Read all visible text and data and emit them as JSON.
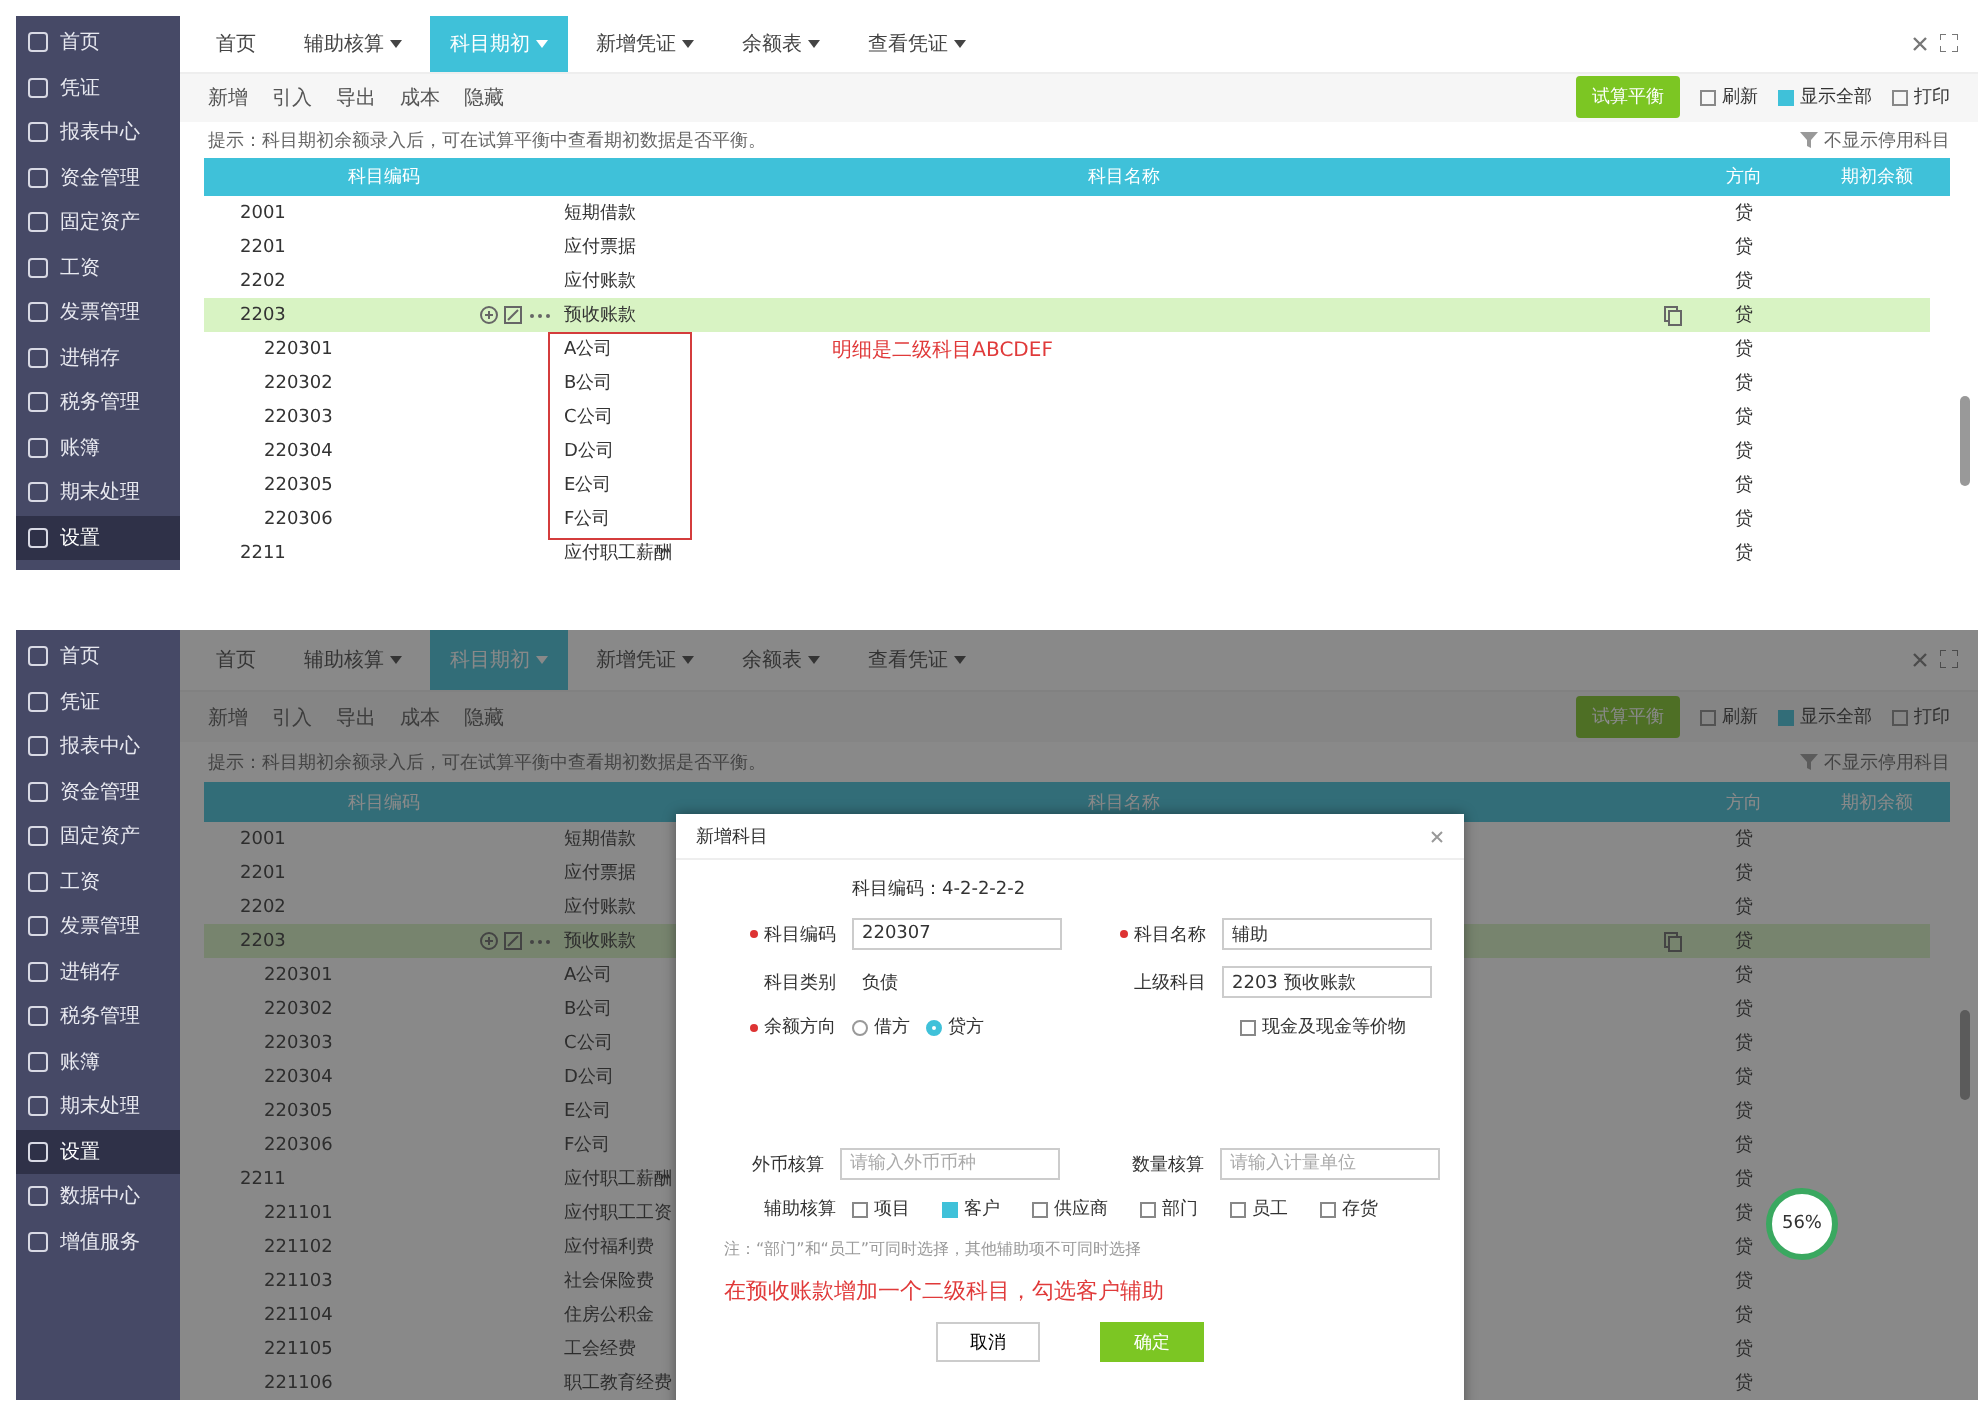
{
  "screens": [
    {
      "sidebar": {
        "items": [
          {
            "label": "首页",
            "selected": false
          },
          {
            "label": "凭证",
            "selected": false
          },
          {
            "label": "报表中心",
            "selected": false
          },
          {
            "label": "资金管理",
            "selected": false
          },
          {
            "label": "固定资产",
            "selected": false
          },
          {
            "label": "工资",
            "selected": false
          },
          {
            "label": "发票管理",
            "selected": false
          },
          {
            "label": "进销存",
            "selected": false
          },
          {
            "label": "税务管理",
            "selected": false
          },
          {
            "label": "账簿",
            "selected": false
          },
          {
            "label": "期末处理",
            "selected": false
          },
          {
            "label": "设置",
            "selected": true
          }
        ]
      },
      "tabs": [
        {
          "label": "首页",
          "selected": false,
          "dropdown": false
        },
        {
          "label": "辅助核算",
          "selected": false,
          "dropdown": true
        },
        {
          "label": "科目期初",
          "selected": true,
          "dropdown": true
        },
        {
          "label": "新增凭证",
          "selected": false,
          "dropdown": true
        },
        {
          "label": "余额表",
          "selected": false,
          "dropdown": true
        },
        {
          "label": "查看凭证",
          "selected": false,
          "dropdown": true
        }
      ],
      "toolbar": [
        "新增",
        "引入",
        "导出",
        "成本",
        "隐藏"
      ],
      "primary_action": "试算平衡",
      "options": [
        {
          "label": "刷新",
          "checked": false
        },
        {
          "label": "显示全部",
          "checked": true
        },
        {
          "label": "打印",
          "checked": false
        }
      ],
      "filter": "不显示停用科目",
      "hint": "提示：科目期初余额录入后，可在试算平衡中查看期初数据是否平衡。",
      "table": {
        "columns": [
          "科目编码",
          "科目名称",
          "方向",
          "期初余额"
        ],
        "rows": [
          {
            "code": "2001",
            "name": "短期借款",
            "direction": "贷",
            "selected": false
          },
          {
            "code": "2201",
            "name": "应付票据",
            "direction": "贷",
            "selected": false
          },
          {
            "code": "2202",
            "name": "应付账款",
            "direction": "贷",
            "selected": false
          },
          {
            "code": "2203",
            "name": "预收账款",
            "direction": "贷",
            "selected": true,
            "children": [
              {
                "code": "220301",
                "name": "A公司",
                "direction": "贷",
                "selected": false
              },
              {
                "code": "220302",
                "name": "B公司",
                "direction": "贷",
                "selected": false
              },
              {
                "code": "220303",
                "name": "C公司",
                "direction": "贷",
                "selected": false
              },
              {
                "code": "220304",
                "name": "D公司",
                "direction": "贷",
                "selected": false
              },
              {
                "code": "220305",
                "name": "E公司",
                "direction": "贷",
                "selected": false
              },
              {
                "code": "220306",
                "name": "F公司",
                "direction": "贷",
                "selected": false
              }
            ]
          },
          {
            "code": "2211",
            "name": "应付职工薪酬",
            "direction": "贷",
            "selected": false
          }
        ]
      },
      "annotation": "明细是二级科目ABCDEF"
    },
    {
      "sidebar": {
        "items": [
          {
            "label": "首页",
            "selected": false
          },
          {
            "label": "凭证",
            "selected": false
          },
          {
            "label": "报表中心",
            "selected": false
          },
          {
            "label": "资金管理",
            "selected": false
          },
          {
            "label": "固定资产",
            "selected": false
          },
          {
            "label": "工资",
            "selected": false
          },
          {
            "label": "发票管理",
            "selected": false
          },
          {
            "label": "进销存",
            "selected": false
          },
          {
            "label": "税务管理",
            "selected": false
          },
          {
            "label": "账簿",
            "selected": false
          },
          {
            "label": "期末处理",
            "selected": false
          },
          {
            "label": "设置",
            "selected": true
          },
          {
            "label": "数据中心",
            "selected": false
          },
          {
            "label": "增值服务",
            "selected": false
          }
        ]
      },
      "tabs": [
        {
          "label": "首页",
          "selected": false,
          "dropdown": false
        },
        {
          "label": "辅助核算",
          "selected": false,
          "dropdown": true
        },
        {
          "label": "科目期初",
          "selected": true,
          "dropdown": true
        },
        {
          "label": "新增凭证",
          "selected": false,
          "dropdown": true
        },
        {
          "label": "余额表",
          "selected": false,
          "dropdown": true
        },
        {
          "label": "查看凭证",
          "selected": false,
          "dropdown": true
        }
      ],
      "toolbar": [
        "新增",
        "引入",
        "导出",
        "成本",
        "隐藏"
      ],
      "primary_action": "试算平衡",
      "options": [
        {
          "label": "刷新",
          "checked": false
        },
        {
          "label": "显示全部",
          "checked": true
        },
        {
          "label": "打印",
          "checked": false
        }
      ],
      "filter": "不显示停用科目",
      "hint": "提示：科目期初余额录入后，可在试算平衡中查看期初数据是否平衡。",
      "table": {
        "columns": [
          "科目编码",
          "科目名称",
          "方向",
          "期初余额"
        ],
        "rows": [
          {
            "code": "2001",
            "name": "短期借款",
            "direction": "贷",
            "selected": false
          },
          {
            "code": "2201",
            "name": "应付票据",
            "direction": "贷",
            "selected": false
          },
          {
            "code": "2202",
            "name": "应付账款",
            "direction": "贷",
            "selected": false
          },
          {
            "code": "2203",
            "name": "预收账款",
            "direction": "贷",
            "selected": true,
            "children": [
              {
                "code": "220301",
                "name": "A公司",
                "direction": "贷",
                "selected": false
              },
              {
                "code": "220302",
                "name": "B公司",
                "direction": "贷",
                "selected": false
              },
              {
                "code": "220303",
                "name": "C公司",
                "direction": "贷",
                "selected": false
              },
              {
                "code": "220304",
                "name": "D公司",
                "direction": "贷",
                "selected": false
              },
              {
                "code": "220305",
                "name": "E公司",
                "direction": "贷",
                "selected": false
              },
              {
                "code": "220306",
                "name": "F公司",
                "direction": "贷",
                "selected": false
              }
            ]
          },
          {
            "code": "2211",
            "name": "应付职工薪酬",
            "direction": "贷",
            "selected": false,
            "children": [
              {
                "code": "221101",
                "name": "应付职工工资",
                "direction": "贷",
                "selected": false
              },
              {
                "code": "221102",
                "name": "应付福利费",
                "direction": "贷",
                "selected": false
              },
              {
                "code": "221103",
                "name": "社会保险费",
                "direction": "贷",
                "selected": false
              },
              {
                "code": "221104",
                "name": "住房公积金",
                "direction": "贷",
                "selected": false
              },
              {
                "code": "221105",
                "name": "工会经费",
                "direction": "贷",
                "selected": false
              },
              {
                "code": "221106",
                "name": "职工教育经费",
                "direction": "贷",
                "selected": false
              }
            ]
          }
        ]
      },
      "modal": {
        "title": "新增科目",
        "rule": "科目编码：4-2-2-2-2",
        "code": {
          "label": "科目编码",
          "required": true,
          "value": "220307"
        },
        "name": {
          "label": "科目名称",
          "required": true,
          "value": "辅助"
        },
        "category": {
          "label": "科目类别",
          "value": "负债"
        },
        "parent": {
          "label": "上级科目",
          "value": "2203 预收账款"
        },
        "direction": {
          "label": "余额方向",
          "required": true,
          "options": [
            {
              "label": "借方",
              "selected": false
            },
            {
              "label": "贷方",
              "selected": true
            }
          ]
        },
        "cash": {
          "label": "现金及现金等价物",
          "checked": false
        },
        "currency": {
          "label": "外币核算",
          "placeholder": "请输入外币币种"
        },
        "quantity": {
          "label": "数量核算",
          "placeholder": "请输入计量单位"
        },
        "auxiliary": {
          "label": "辅助核算",
          "options": [
            {
              "label": "项目",
              "checked": false
            },
            {
              "label": "客户",
              "checked": true
            },
            {
              "label": "供应商",
              "checked": false
            },
            {
              "label": "部门",
              "checked": false
            },
            {
              "label": "员工",
              "checked": false
            },
            {
              "label": "存货",
              "checked": false
            }
          ]
        },
        "note": "注：“部门”和“员工”可同时选择，其他辅助项不可同时选择",
        "annotation": "在预收账款增加一个二级科目，勾选客户辅助",
        "buttons": [
          {
            "label": "取消",
            "kind": "default"
          },
          {
            "label": "确定",
            "kind": "primary"
          }
        ]
      },
      "progress": "56%"
    }
  ]
}
